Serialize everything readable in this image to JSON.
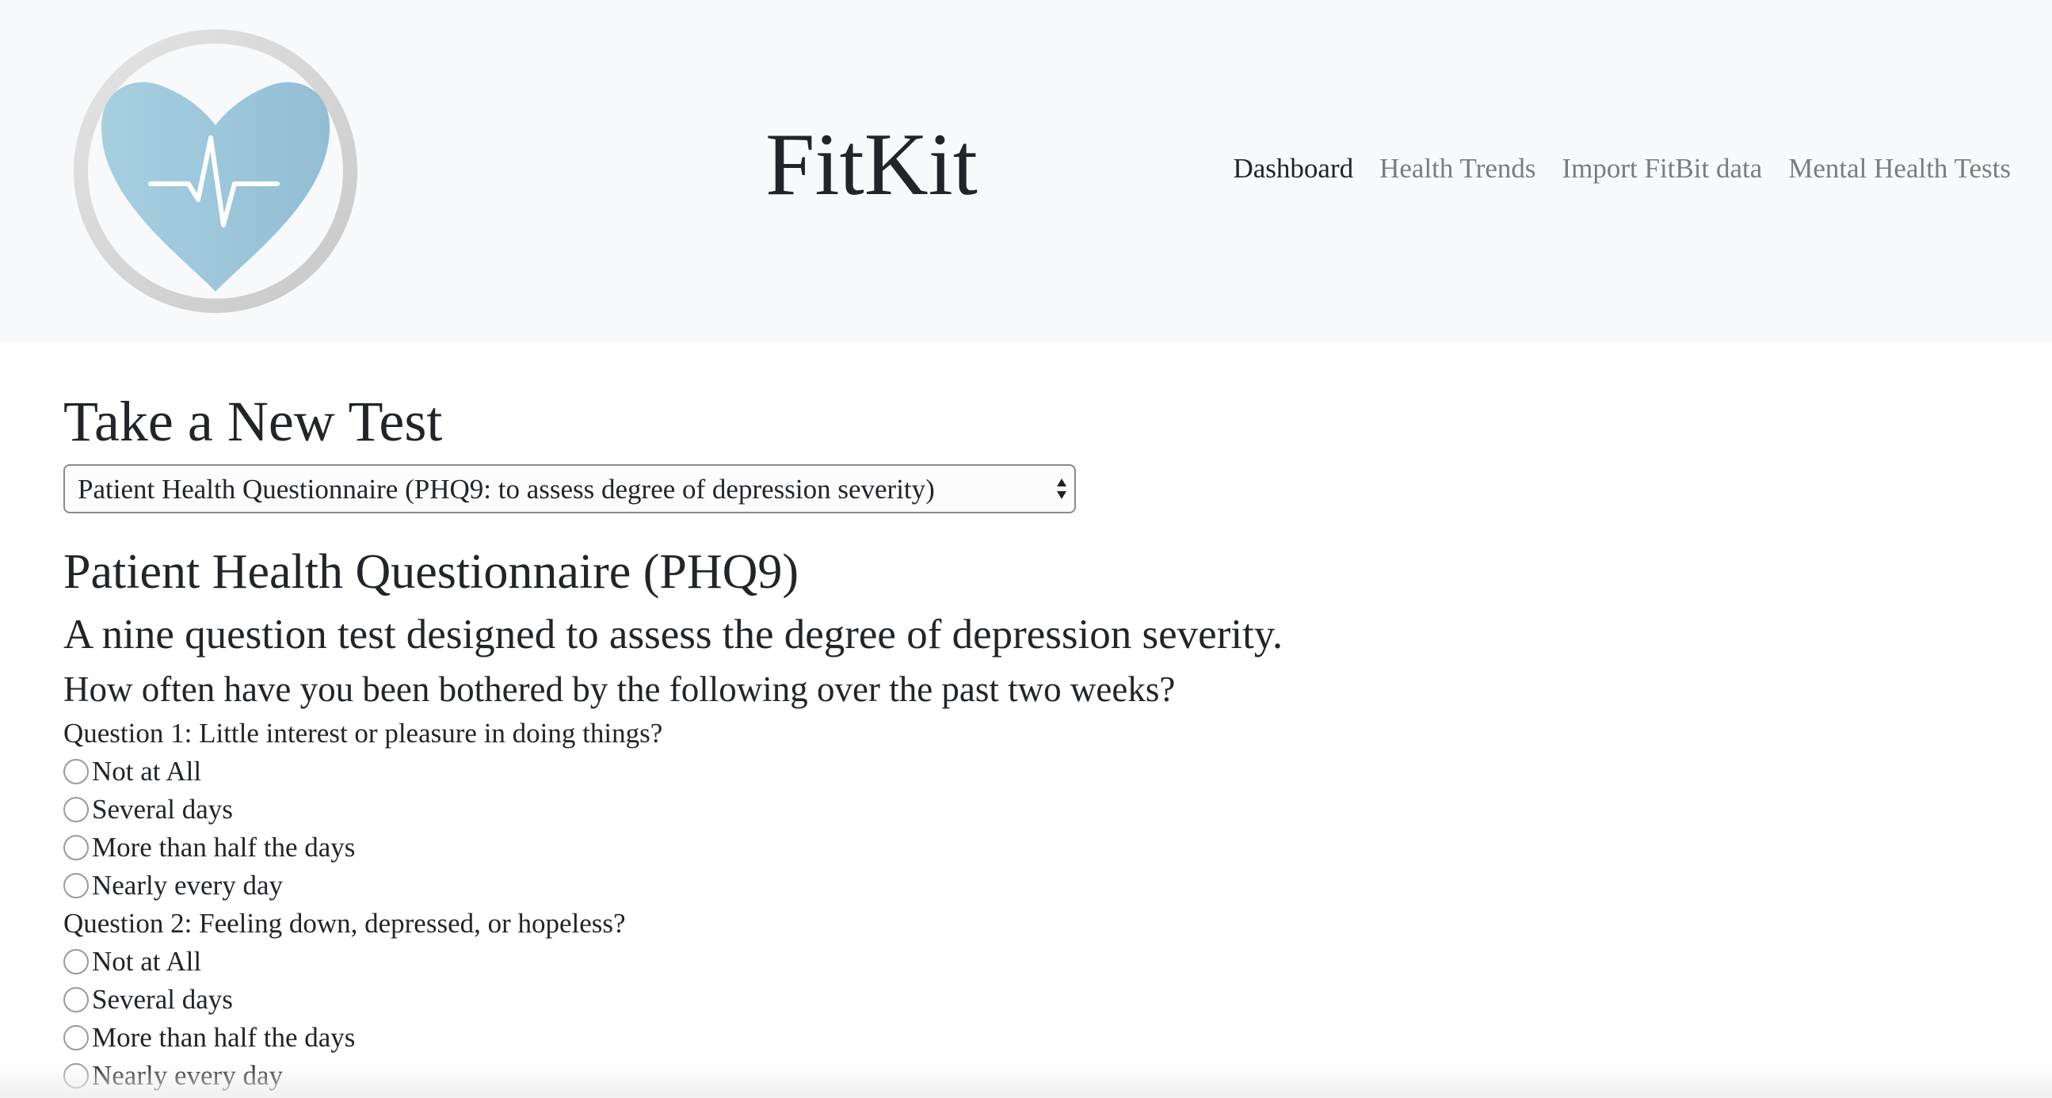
{
  "header": {
    "logo_icon": "heart-heartbeat-logo-icon",
    "brand": "FitKit",
    "nav": [
      {
        "label": "Dashboard",
        "active": true
      },
      {
        "label": "Health Trends",
        "active": false
      },
      {
        "label": "Import FitBit data",
        "active": false
      },
      {
        "label": "Mental Health Tests",
        "active": false
      }
    ]
  },
  "main": {
    "page_title": "Take a New Test",
    "test_select": {
      "selected": "Patient Health Questionnaire (PHQ9: to assess degree of depression severity)",
      "arrow_icon": "select-arrows-icon"
    },
    "test_title": "Patient Health Questionnaire (PHQ9)",
    "test_description": "A nine question test designed to assess the degree of depression severity.",
    "instructions": "How often have you been bothered by the following over the past two weeks?",
    "questions": [
      {
        "label": "Question 1: Little interest or pleasure in doing things?",
        "options": [
          "Not at All",
          "Several days",
          "More than half the days",
          "Nearly every day"
        ]
      },
      {
        "label": "Question 2: Feeling down, depressed, or hopeless?",
        "options": [
          "Not at All",
          "Several days",
          "More than half the days",
          "Nearly every day"
        ]
      }
    ]
  },
  "colors": {
    "header_bg": "#f8f9fa",
    "text": "#212529",
    "nav_inactive": "#7a7d80",
    "logo_heart": "#9fc8dc",
    "logo_ring": "#d3d3d3"
  }
}
